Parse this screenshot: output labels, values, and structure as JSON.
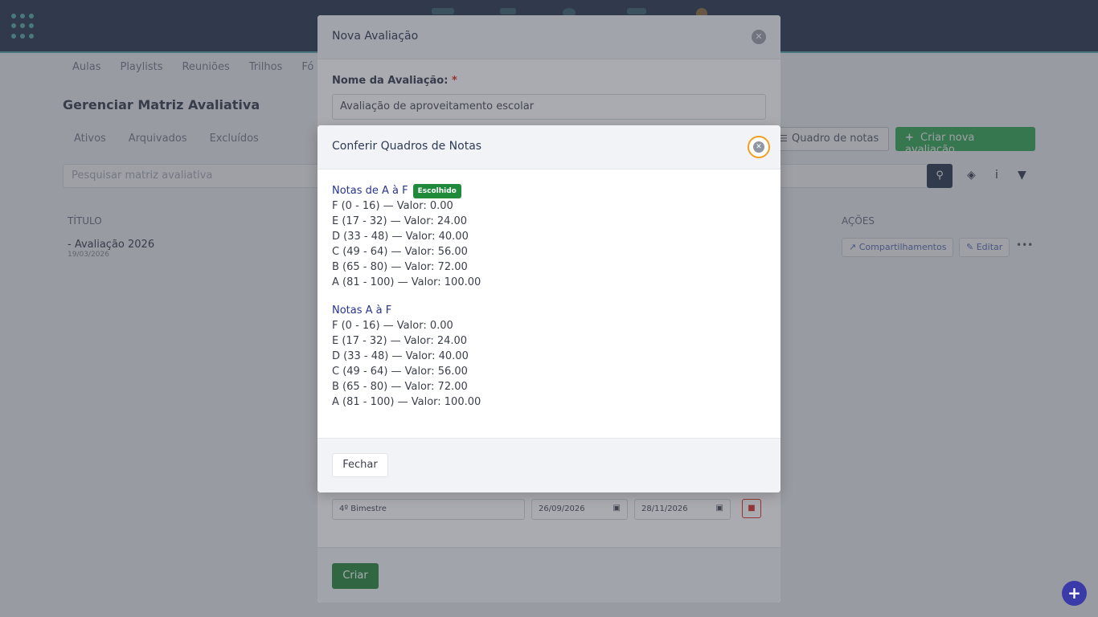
{
  "background": {
    "subnav": [
      "Aulas",
      "Playlists",
      "Reuniões",
      "Trilhos",
      "Fó"
    ],
    "page_title": "Gerenciar Matriz Avaliativa",
    "tabs": [
      "Ativos",
      "Arquivados",
      "Excluídos"
    ],
    "search_placeholder": "Pesquisar matriz avaliativa",
    "btn_quadro": "Quadro de notas",
    "btn_criar_nova": "Criar nova avaliação",
    "col_titulo": "TÍTULO",
    "col_acoes": "AÇÕES",
    "row_title": "- Avaliação 2026",
    "row_date": "19/03/2026",
    "btn_compartilhamentos": "Compartilhamentos",
    "btn_editar": "Editar",
    "icons": {
      "search": "search-icon",
      "layers": "layers-icon",
      "info": "info-icon",
      "filter": "filter-icon",
      "apps": "apps-grid-icon"
    }
  },
  "modal_nova": {
    "title": "Nova Avaliação",
    "name_label": "Nome da Avaliação:",
    "required_mark": "*",
    "name_value": "Avaliação de aproveitamento escolar",
    "period_name": "4º Bimestre",
    "period_start": "26/09/2026",
    "period_end": "28/11/2026",
    "btn_criar": "Criar"
  },
  "modal_quadros": {
    "title": "Conferir Quadros de Notas",
    "groups": [
      {
        "title": "Notas de A à F",
        "badge": "Escolhido",
        "lines": [
          "F (0 - 16) — Valor: 0.00",
          "E (17 - 32) — Valor: 24.00",
          "D (33 - 48) — Valor: 40.00",
          "C (49 - 64) — Valor: 56.00",
          "B (65 - 80) — Valor: 72.00",
          "A (81 - 100) — Valor: 100.00"
        ]
      },
      {
        "title": "Notas A à F",
        "lines": [
          "F (0 - 16) — Valor: 0.00",
          "E (17 - 32) — Valor: 24.00",
          "D (33 - 48) — Valor: 40.00",
          "C (49 - 64) — Valor: 56.00",
          "B (65 - 80) — Valor: 72.00",
          "A (81 - 100) — Valor: 100.00"
        ]
      }
    ],
    "btn_fechar": "Fechar"
  },
  "colors": {
    "topbar": "#2f3c55",
    "accent": "#5fb3b3",
    "success": "#3bb05a",
    "badge": "#1f8b3a",
    "link": "#27358c",
    "focus_ring": "#f0a020"
  }
}
